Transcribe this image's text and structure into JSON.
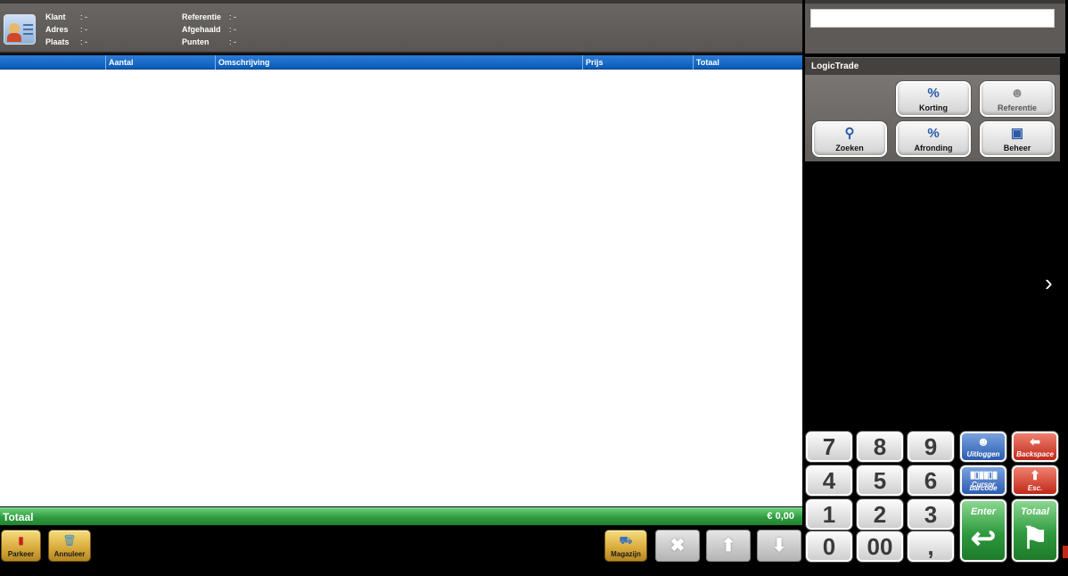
{
  "customer": {
    "klant_label": "Klant",
    "klant_value": ": -",
    "adres_label": "Adres",
    "adres_value": ": -",
    "plaats_label": "Plaats",
    "plaats_value": ": -",
    "referentie_label": "Referentie",
    "referentie_value": ": -",
    "afgehaald_label": "Afgehaald",
    "afgehaald_value": ": -",
    "punten_label": "Punten",
    "punten_value": ": -"
  },
  "search": {
    "value": "",
    "placeholder": ""
  },
  "table": {
    "columns": [
      "Aantal",
      "Omschrijving",
      "Prijs",
      "Totaal"
    ]
  },
  "totals": {
    "label": "Totaal",
    "value": "€ 0,00"
  },
  "bottom_buttons": {
    "parkeer": "Parkeer",
    "annuleer": "Annuleer",
    "magazijn": "Magazijn",
    "delete_glyph": "✖",
    "up_glyph": "⬆",
    "down_glyph": "⬇"
  },
  "panel": {
    "title": "LogicTrade",
    "korting": "Korting",
    "referentie": "Referentie",
    "zoeken": "Zoeken",
    "afronding": "Afronding",
    "beheer": "Beheer"
  },
  "keypad": {
    "k7": "7",
    "k8": "8",
    "k9": "9",
    "k4": "4",
    "k5": "5",
    "k6": "6",
    "k1": "1",
    "k2": "2",
    "k3": "3",
    "k0": "0",
    "k00": "00",
    "kcomma": ",",
    "uitloggen": "Uitloggen",
    "backspace": "Backspace",
    "cursor_line1": "Cursor",
    "cursor_line2": "barcode",
    "esc": "Esc.",
    "enter": "Enter",
    "totaal": "Totaal"
  },
  "colors": {
    "header_blue": "#0a5bb8",
    "total_green": "#2f9a3e",
    "gold": "#d8a93a",
    "red": "#c02818"
  }
}
